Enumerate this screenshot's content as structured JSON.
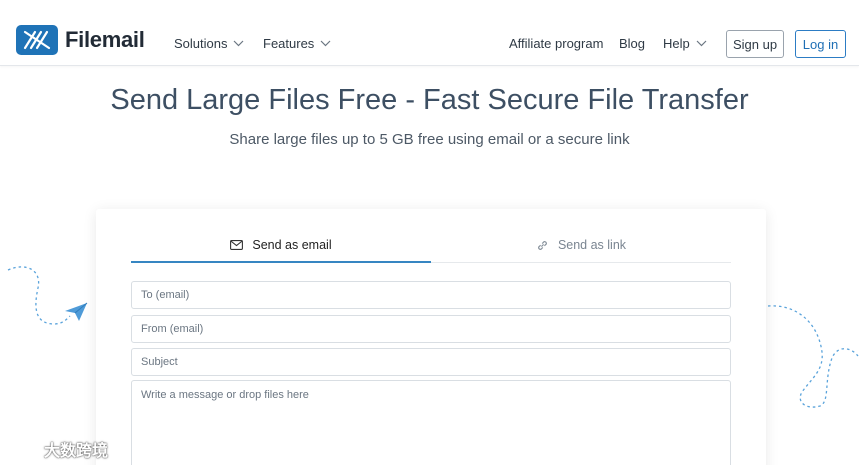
{
  "brand": {
    "name": "Filemail",
    "color": "#1f73b7"
  },
  "nav": {
    "solutions": "Solutions",
    "features": "Features",
    "affiliate": "Affiliate program",
    "blog": "Blog",
    "help": "Help",
    "signup": "Sign up",
    "login": "Log in"
  },
  "hero": {
    "title": "Send Large Files Free - Fast Secure File Transfer",
    "subtitle": "Share large files up to 5 GB free using email or a secure link"
  },
  "tabs": {
    "email": "Send as email",
    "link": "Send as link",
    "active": "email"
  },
  "form": {
    "to_placeholder": "To (email)",
    "from_placeholder": "From (email)",
    "subject_placeholder": "Subject",
    "message_placeholder": "Write a message or drop files here"
  },
  "colors": {
    "accent": "#3686c2",
    "deco": "#5aa3db"
  },
  "watermark": "大数跨境",
  "icons": [
    "chevron-down-icon",
    "mail-icon",
    "link-icon",
    "paper-plane-icon"
  ]
}
